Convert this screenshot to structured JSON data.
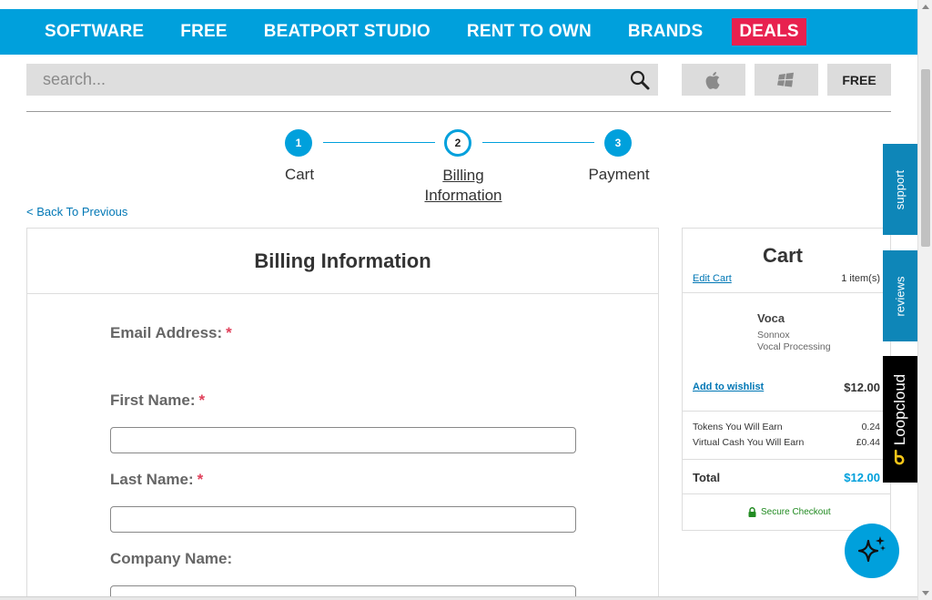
{
  "nav": {
    "items": [
      "SOFTWARE",
      "FREE",
      "BEATPORT STUDIO",
      "RENT TO OWN",
      "BRANDS"
    ],
    "deals": "DEALS"
  },
  "search": {
    "placeholder": "search..."
  },
  "platforms": {
    "free_label": "FREE"
  },
  "steps": [
    {
      "number": "1",
      "label": "Cart"
    },
    {
      "number": "2",
      "label": "Billing Information"
    },
    {
      "number": "3",
      "label": "Payment"
    }
  ],
  "back_link": "< Back To Previous",
  "billing": {
    "title": "Billing Information",
    "email_label": "Email Address:",
    "first_name_label": "First Name:",
    "last_name_label": "Last Name:",
    "company_label": "Company Name:",
    "required_mark": "*"
  },
  "cart": {
    "title": "Cart",
    "edit_cart": "Edit Cart",
    "item_count": "1 item(s)",
    "product": {
      "name": "Voca",
      "brand": "Sonnox",
      "category": "Vocal Processing",
      "price": "$12.00"
    },
    "add_to_wishlist": "Add to wishlist",
    "tokens_label": "Tokens You Will Earn",
    "tokens_value": "0.24",
    "cash_label": "Virtual Cash You Will Earn",
    "cash_value": "£0.44",
    "total_label": "Total",
    "total_value": "$12.00",
    "secure_checkout": "Secure Checkout"
  },
  "side_tabs": {
    "support": "support",
    "reviews": "reviews",
    "loopcloud": "Loopcloud"
  },
  "colors": {
    "brand_blue": "#00a0dc",
    "deals_red": "#e8214f",
    "tab_blue": "#0e86b8",
    "required_red": "#e0405a",
    "secure_green": "#228b22"
  }
}
